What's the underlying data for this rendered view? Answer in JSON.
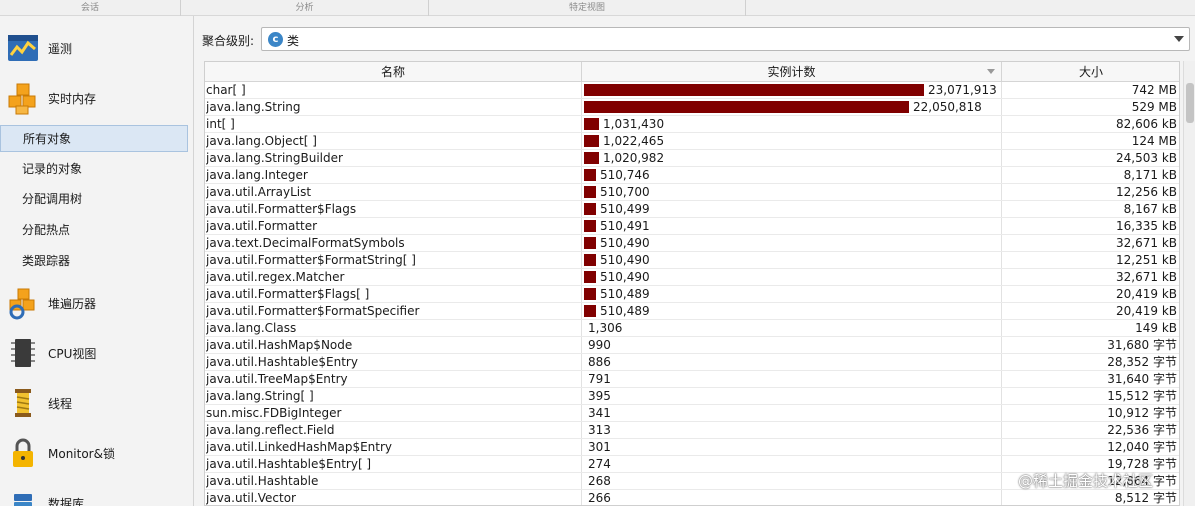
{
  "top_tabs": [
    "会话",
    "分析",
    "特定视图"
  ],
  "sidebar": {
    "big": [
      {
        "label": "遥测",
        "icon": "telemetry-icon"
      },
      {
        "label": "实时内存",
        "icon": "live-memory-icon"
      }
    ],
    "sub": [
      {
        "label": "所有对象",
        "active": true
      },
      {
        "label": "记录的对象",
        "active": false
      },
      {
        "label": "分配调用树",
        "active": false
      },
      {
        "label": "分配热点",
        "active": false
      },
      {
        "label": "类跟踪器",
        "active": false
      }
    ],
    "big2": [
      {
        "label": "堆遍历器",
        "icon": "heap-walker-icon"
      },
      {
        "label": "CPU视图",
        "icon": "cpu-icon"
      },
      {
        "label": "线程",
        "icon": "threads-icon"
      },
      {
        "label": "Monitor&锁",
        "icon": "lock-icon"
      },
      {
        "label": "数据库",
        "icon": "database-icon"
      }
    ]
  },
  "aggregation": {
    "label": "聚合级别:",
    "value": "类",
    "icon": "class-icon"
  },
  "table": {
    "headers": {
      "name": "名称",
      "count": "实例计数",
      "size": "大小"
    },
    "max_count": 23071913,
    "bar_color": "#800000",
    "rows": [
      {
        "name": "char[ ]",
        "count": 23071913,
        "count_label": "23,071,913",
        "size": "742 MB"
      },
      {
        "name": "java.lang.String",
        "count": 22050818,
        "count_label": "22,050,818",
        "size": "529 MB"
      },
      {
        "name": "int[ ]",
        "count": 1031430,
        "count_label": "1,031,430",
        "size": "82,606 kB"
      },
      {
        "name": "java.lang.Object[ ]",
        "count": 1022465,
        "count_label": "1,022,465",
        "size": "124 MB"
      },
      {
        "name": "java.lang.StringBuilder",
        "count": 1020982,
        "count_label": "1,020,982",
        "size": "24,503 kB"
      },
      {
        "name": "java.lang.Integer",
        "count": 510746,
        "count_label": "510,746",
        "size": "8,171 kB"
      },
      {
        "name": "java.util.ArrayList",
        "count": 510700,
        "count_label": "510,700",
        "size": "12,256 kB"
      },
      {
        "name": "java.util.Formatter$Flags",
        "count": 510499,
        "count_label": "510,499",
        "size": "8,167 kB"
      },
      {
        "name": "java.util.Formatter",
        "count": 510491,
        "count_label": "510,491",
        "size": "16,335 kB"
      },
      {
        "name": "java.text.DecimalFormatSymbols",
        "count": 510490,
        "count_label": "510,490",
        "size": "32,671 kB"
      },
      {
        "name": "java.util.Formatter$FormatString[ ]",
        "count": 510490,
        "count_label": "510,490",
        "size": "12,251 kB"
      },
      {
        "name": "java.util.regex.Matcher",
        "count": 510490,
        "count_label": "510,490",
        "size": "32,671 kB"
      },
      {
        "name": "java.util.Formatter$Flags[ ]",
        "count": 510489,
        "count_label": "510,489",
        "size": "20,419 kB"
      },
      {
        "name": "java.util.Formatter$FormatSpecifier",
        "count": 510489,
        "count_label": "510,489",
        "size": "20,419 kB"
      },
      {
        "name": "java.lang.Class",
        "count": 1306,
        "count_label": "1,306",
        "size": "149 kB"
      },
      {
        "name": "java.util.HashMap$Node",
        "count": 990,
        "count_label": "990",
        "size": "31,680 字节"
      },
      {
        "name": "java.util.Hashtable$Entry",
        "count": 886,
        "count_label": "886",
        "size": "28,352 字节"
      },
      {
        "name": "java.util.TreeMap$Entry",
        "count": 791,
        "count_label": "791",
        "size": "31,640 字节"
      },
      {
        "name": "java.lang.String[ ]",
        "count": 395,
        "count_label": "395",
        "size": "15,512 字节"
      },
      {
        "name": "sun.misc.FDBigInteger",
        "count": 341,
        "count_label": "341",
        "size": "10,912 字节"
      },
      {
        "name": "java.lang.reflect.Field",
        "count": 313,
        "count_label": "313",
        "size": "22,536 字节"
      },
      {
        "name": "java.util.LinkedHashMap$Entry",
        "count": 301,
        "count_label": "301",
        "size": "12,040 字节"
      },
      {
        "name": "java.util.Hashtable$Entry[ ]",
        "count": 274,
        "count_label": "274",
        "size": "19,728 字节"
      },
      {
        "name": "java.util.Hashtable",
        "count": 268,
        "count_label": "268",
        "size": "12,864 字节"
      },
      {
        "name": "java.util.Vector",
        "count": 266,
        "count_label": "266",
        "size": "8,512 字节"
      }
    ]
  },
  "watermark": "@稀土掘金技术社区"
}
